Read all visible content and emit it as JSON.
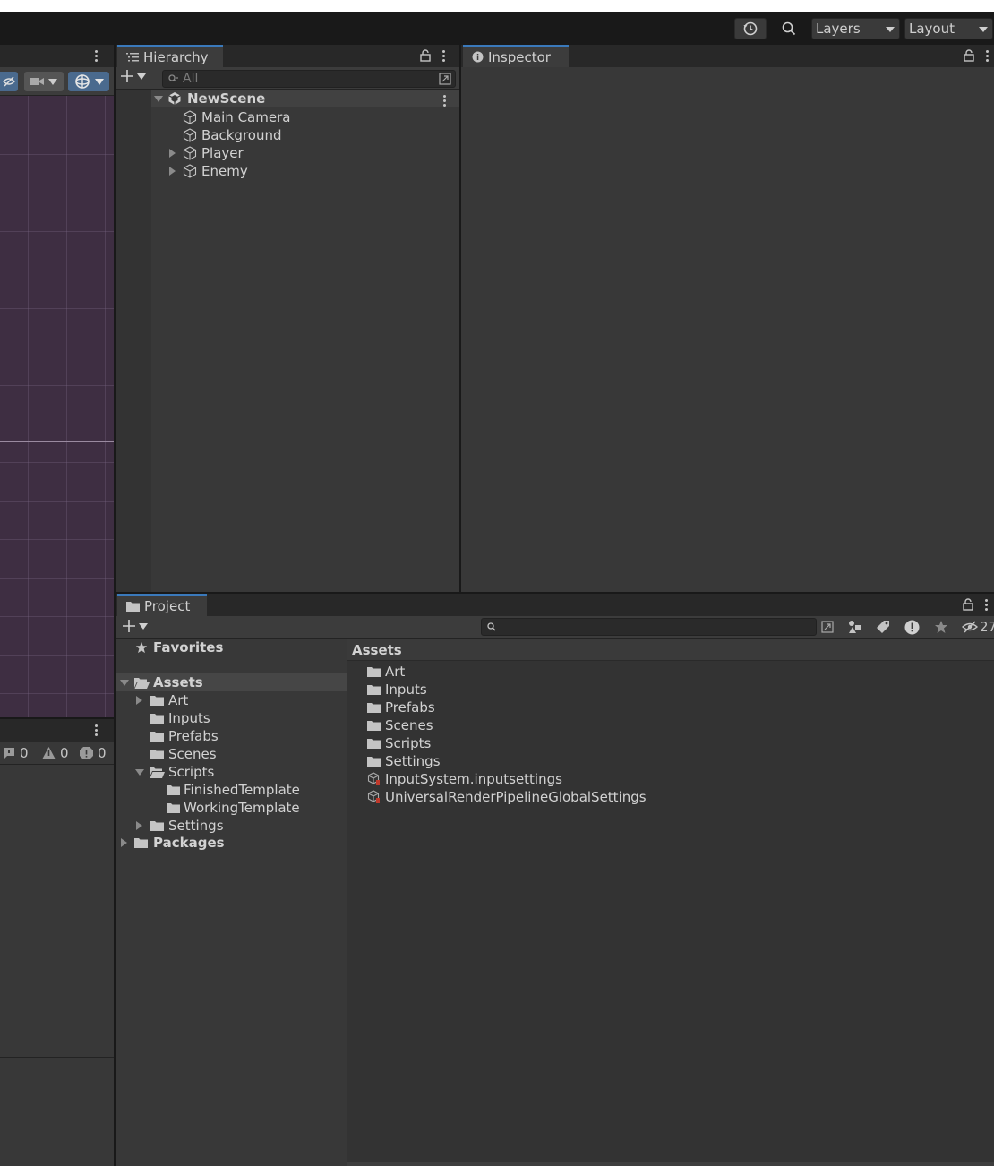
{
  "toolbar": {
    "layers_label": "Layers",
    "layout_label": "Layout",
    "history_icon": "history-icon",
    "search_icon": "search-icon"
  },
  "console": {
    "info_count": "0",
    "warning_count": "0",
    "error_count": "0"
  },
  "hierarchy": {
    "tab_label": "Hierarchy",
    "search_placeholder": "All",
    "scene_name": "NewScene",
    "items": [
      {
        "label": "Main Camera"
      },
      {
        "label": "Background"
      },
      {
        "label": "Player"
      },
      {
        "label": "Enemy"
      }
    ]
  },
  "inspector": {
    "tab_label": "Inspector"
  },
  "project": {
    "tab_label": "Project",
    "hidden_count": "27",
    "tree": {
      "favorites": "Favorites",
      "assets": "Assets",
      "art": "Art",
      "inputs": "Inputs",
      "prefabs": "Prefabs",
      "scenes": "Scenes",
      "scripts": "Scripts",
      "finished": "FinishedTemplate",
      "working": "WorkingTemplate",
      "settings": "Settings",
      "packages": "Packages"
    },
    "breadcrumb": "Assets",
    "files": [
      {
        "label": "Art",
        "kind": "folder"
      },
      {
        "label": "Inputs",
        "kind": "folder"
      },
      {
        "label": "Prefabs",
        "kind": "folder"
      },
      {
        "label": "Scenes",
        "kind": "folder"
      },
      {
        "label": "Scripts",
        "kind": "folder"
      },
      {
        "label": "Settings",
        "kind": "folder"
      },
      {
        "label": "InputSystem.inputsettings",
        "kind": "asset"
      },
      {
        "label": "UniversalRenderPipelineGlobalSettings",
        "kind": "asset"
      }
    ]
  },
  "colors": {
    "accent": "#3a79bb",
    "panel": "#383838",
    "scene_bg": "#3e2e42"
  }
}
